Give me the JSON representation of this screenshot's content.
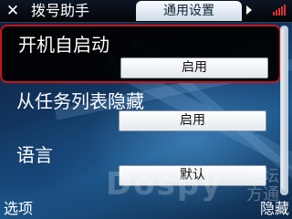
{
  "header": {
    "title": "拨号助手",
    "active_tab": "通用设置",
    "close_icon": "close-icon",
    "next_tab_icon": "chevron-right-icon"
  },
  "settings": [
    {
      "label": "开机自启动",
      "value": "启用",
      "selected": true
    },
    {
      "label": "从任务列表隐藏",
      "value": "启用",
      "selected": false
    },
    {
      "label": "语言",
      "value": "默认",
      "selected": false
    }
  ],
  "softkeys": {
    "left": "选项",
    "right": "隐藏"
  },
  "colors": {
    "selection_border": "#c4161c",
    "signal_indicator": "#e03030",
    "background": "#12355f"
  }
}
